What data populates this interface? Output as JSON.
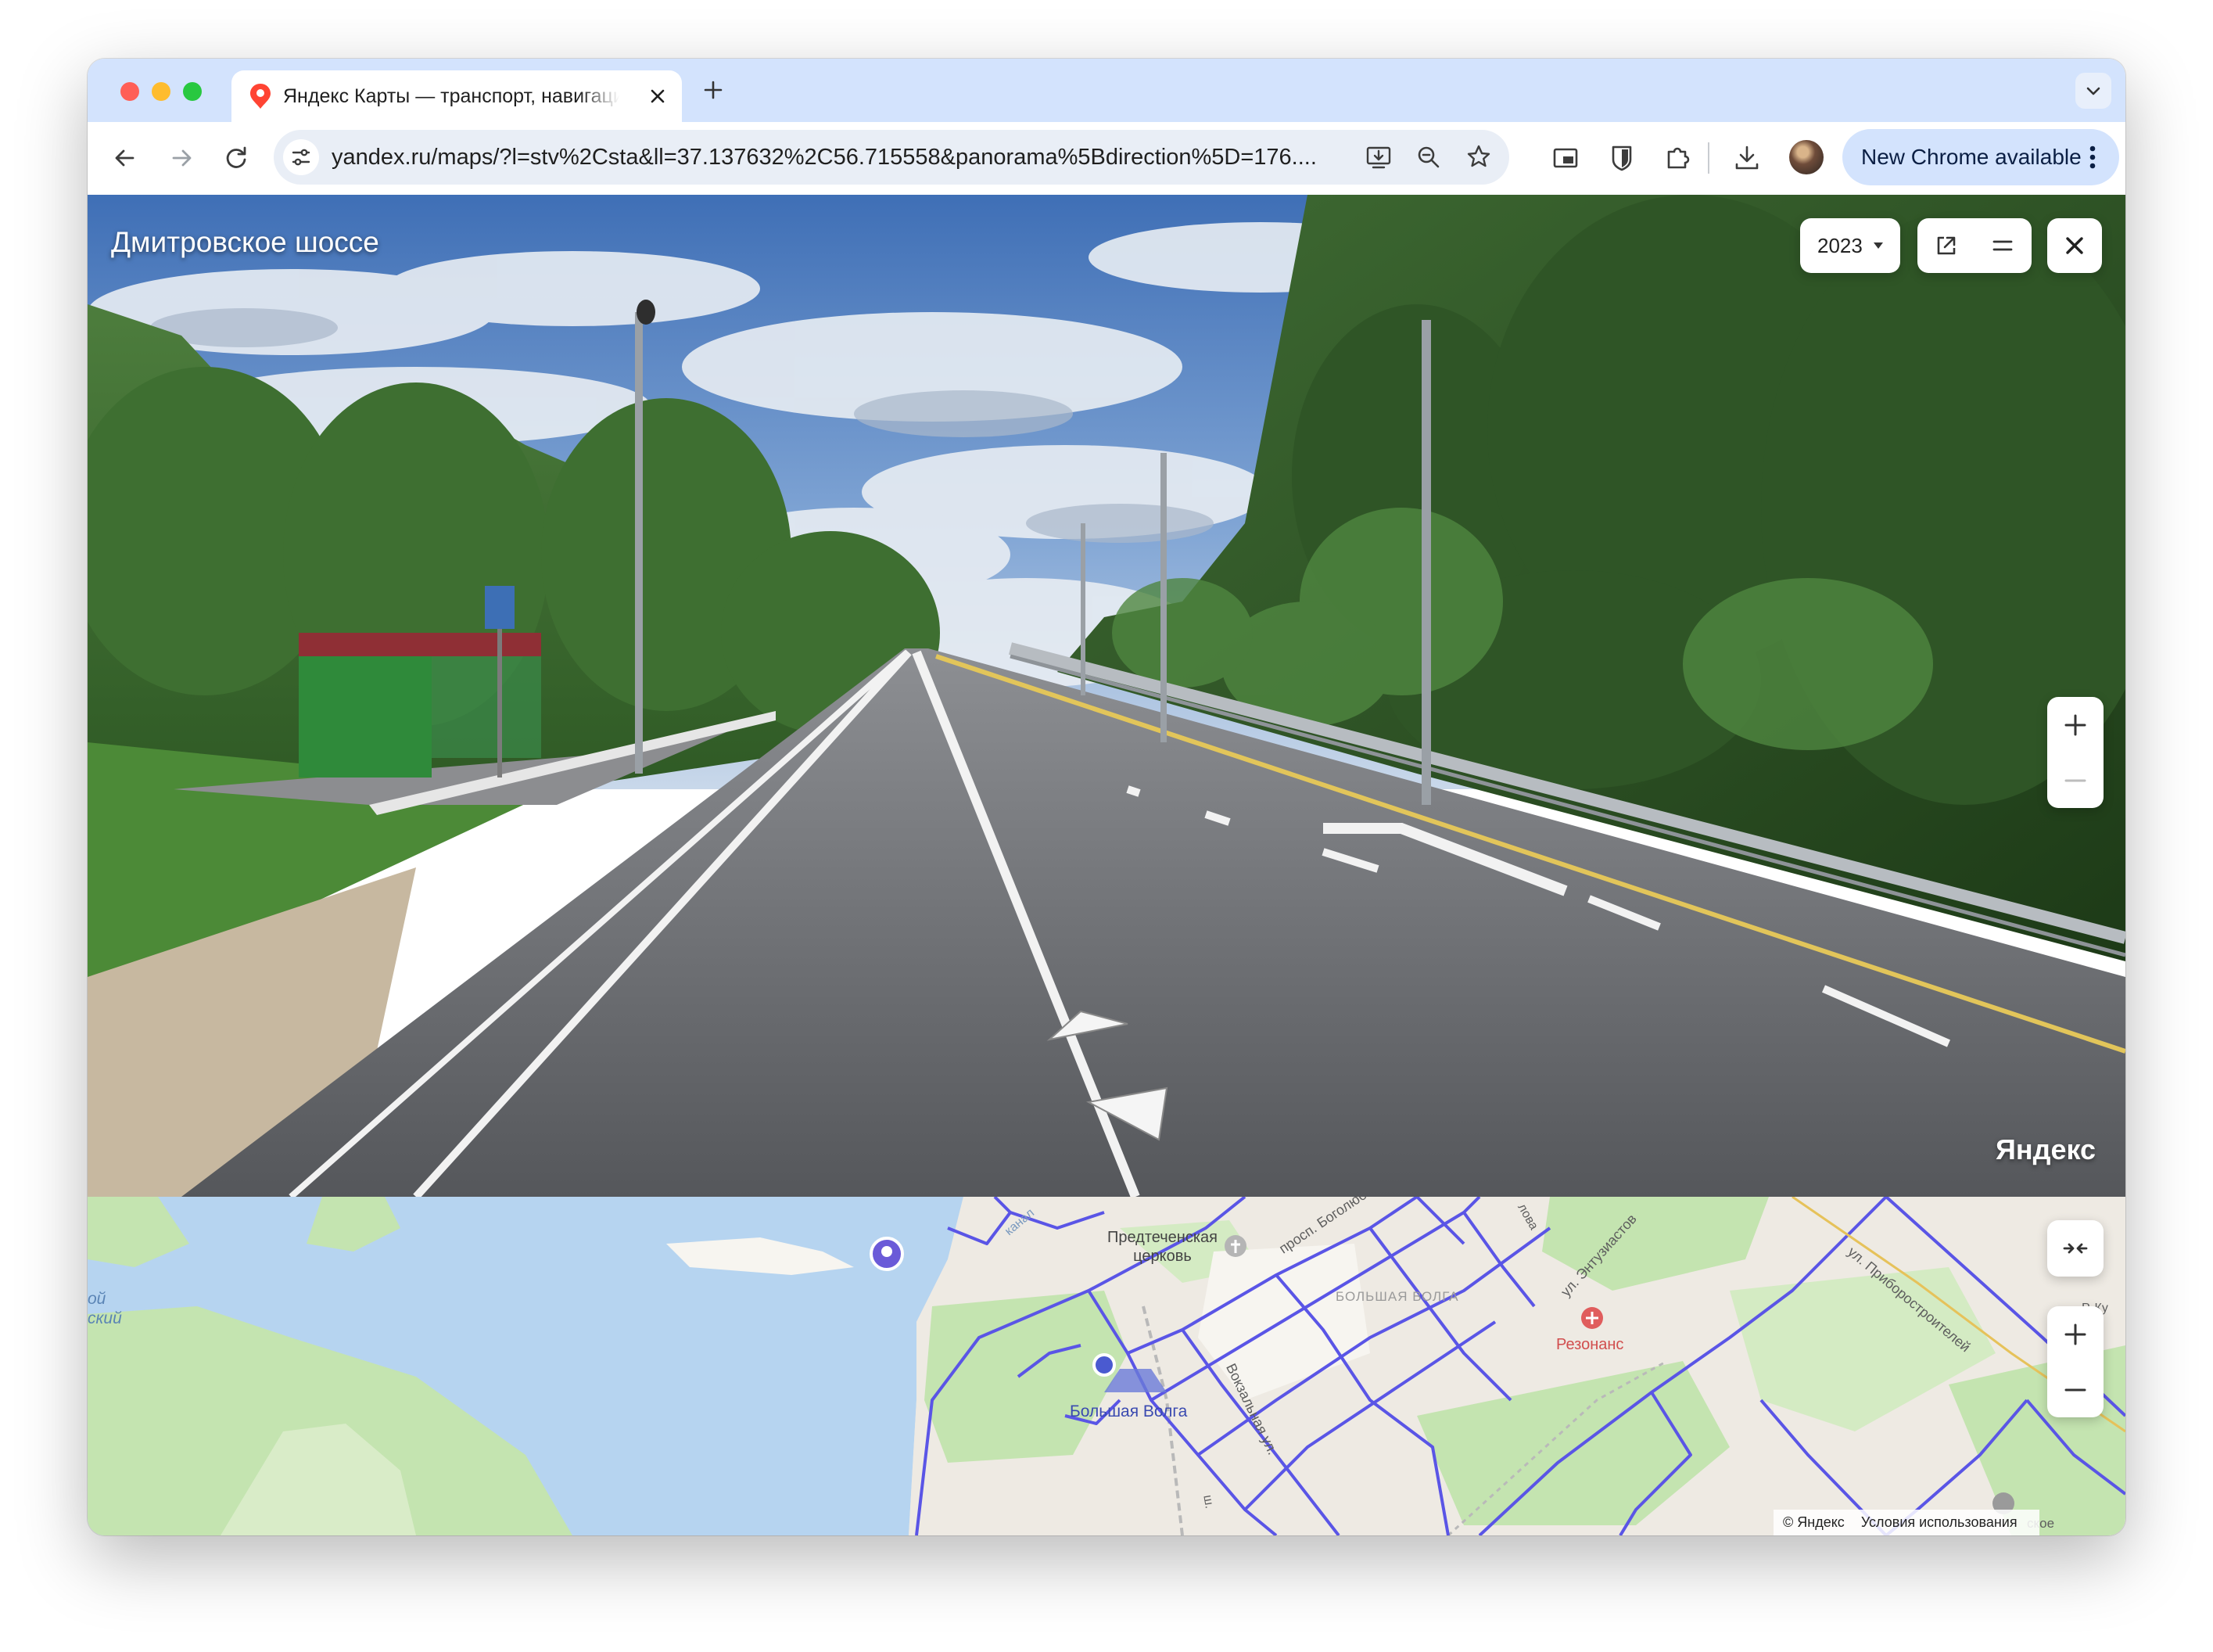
{
  "browser": {
    "tab": {
      "title": "Яндекс Карты — транспорт, навигация, поиск мест"
    },
    "url": "yandex.ru/maps/?l=stv%2Csta&ll=37.137632%2C56.715558&panorama%5Bdirection%5D=176....",
    "update_label": "New Chrome available"
  },
  "panorama": {
    "street_name": "Дмитровское шоссе",
    "year": "2023",
    "watermark": "Яндекс"
  },
  "map": {
    "labels": {
      "church": "Предтеченская\nцерковь",
      "station": "Большая Волга",
      "district": "БОЛЬШАЯ ВОЛГА",
      "clinic": "Резонанс",
      "street_bogolyubova": "просп. Боголюбова",
      "street_entuziastov": "ул. Энтузиастов",
      "street_vokzalnaya": "Вокзальная ул.",
      "street_priborostroiteley": "ул. Приборостроителей",
      "street_kanal": "канал",
      "street_lyubova": "лова",
      "left_fragment": "ой\nский",
      "road_sh": "ш.",
      "road_skoe": "ское",
      "right_fragment": "Р. Ку"
    },
    "copyright": "© Яндекс",
    "terms": "Условия использования"
  },
  "colors": {
    "tabstrip": "#d3e3fd",
    "water": "#b6d4f0",
    "forest": "#c4e4b0",
    "route_lines": "#5a55e6",
    "clinic": "#e05d5d"
  }
}
